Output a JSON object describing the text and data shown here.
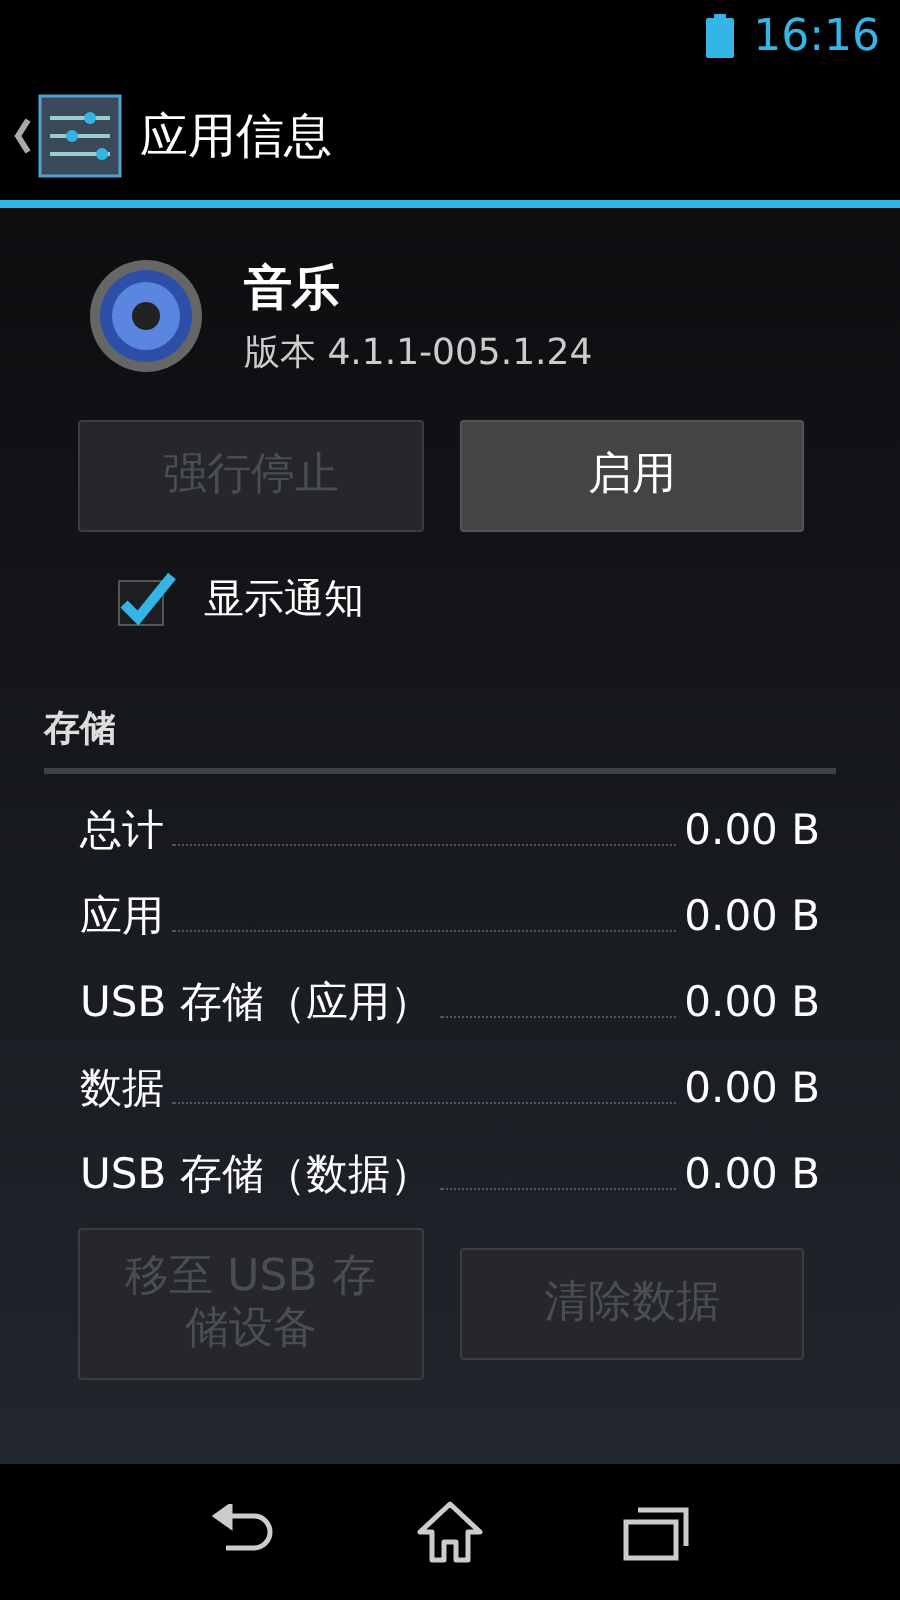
{
  "status_bar": {
    "time": "16:16"
  },
  "action_bar": {
    "title": "应用信息"
  },
  "app": {
    "name": "音乐",
    "version": "版本 4.1.1-005.1.24"
  },
  "buttons": [
    {
      "label": "强行停止",
      "disabled": true
    },
    {
      "label": "启用",
      "disabled": false
    }
  ],
  "notification": {
    "label": "显示通知",
    "checked": true
  },
  "storage": {
    "header": "存储",
    "rows": [
      {
        "label": "总计",
        "value": "0.00 B"
      },
      {
        "label": "应用",
        "value": "0.00 B"
      },
      {
        "label": "USB 存储（应用）",
        "value": "0.00 B"
      },
      {
        "label": "数据",
        "value": "0.00 B"
      },
      {
        "label": "USB 存储（数据）",
        "value": "0.00 B"
      }
    ],
    "buttons": [
      {
        "label": "移至 USB 存储设备",
        "disabled": true
      },
      {
        "label": "清除数据",
        "disabled": true
      }
    ]
  }
}
